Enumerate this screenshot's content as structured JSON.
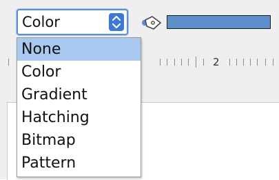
{
  "fill_type_select": {
    "selected": "Color",
    "options": [
      "None",
      "Color",
      "Gradient",
      "Hatching",
      "Bitmap",
      "Pattern"
    ],
    "highlighted_index": 0
  },
  "fill_color": {
    "swatch_color": "#5d8ec9",
    "bucket_icon": "paint-bucket-icon"
  },
  "ruler": {
    "visible_number": "2"
  },
  "colors": {
    "accent": "#3c7ad6",
    "highlight": "#a8c8f0",
    "toolbar_bg": "#efefef"
  }
}
